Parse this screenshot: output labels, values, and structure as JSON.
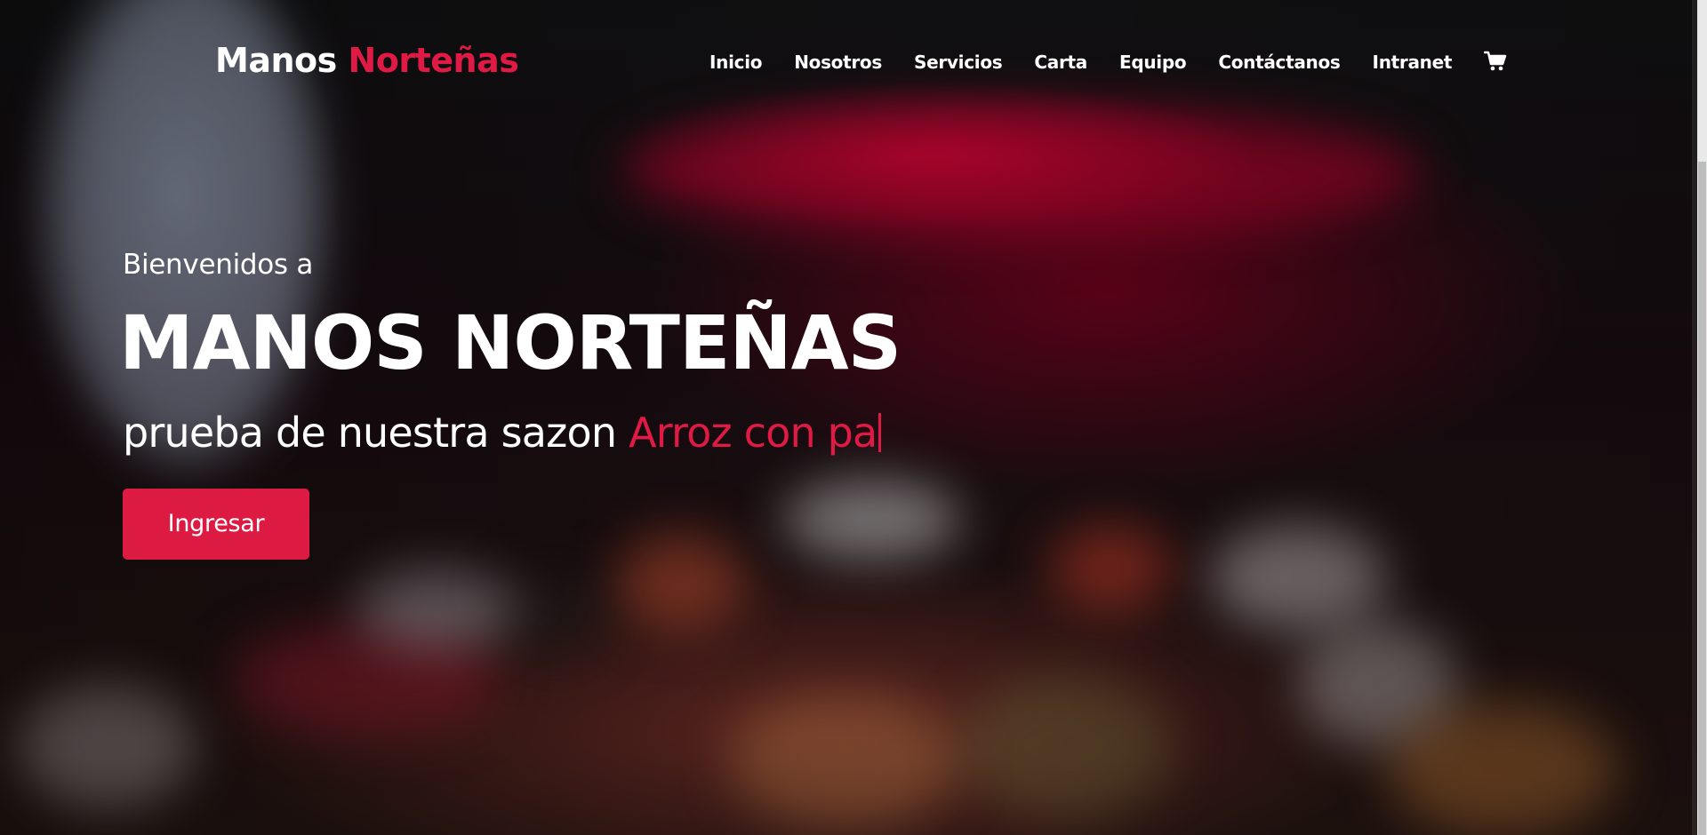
{
  "header": {
    "brand_part1": "Manos ",
    "brand_part2": "Norteñas",
    "nav": {
      "inicio": "Inicio",
      "nosotros": "Nosotros",
      "servicios": "Servicios",
      "carta": "Carta",
      "equipo": "Equipo",
      "contactanos": "Contáctanos",
      "intranet": "Intranet"
    },
    "cart_icon": "shopping-cart-icon"
  },
  "hero": {
    "welcome": "Bienvenidos a",
    "title": "MANOS NORTEÑAS",
    "tagline_prefix": "prueba de nuestra sazon ",
    "tagline_typed": "Arroz con pa",
    "cta_label": "Ingresar"
  },
  "colors": {
    "accent": "#e01a44",
    "text": "#ffffff",
    "button": "#dc1a42"
  }
}
